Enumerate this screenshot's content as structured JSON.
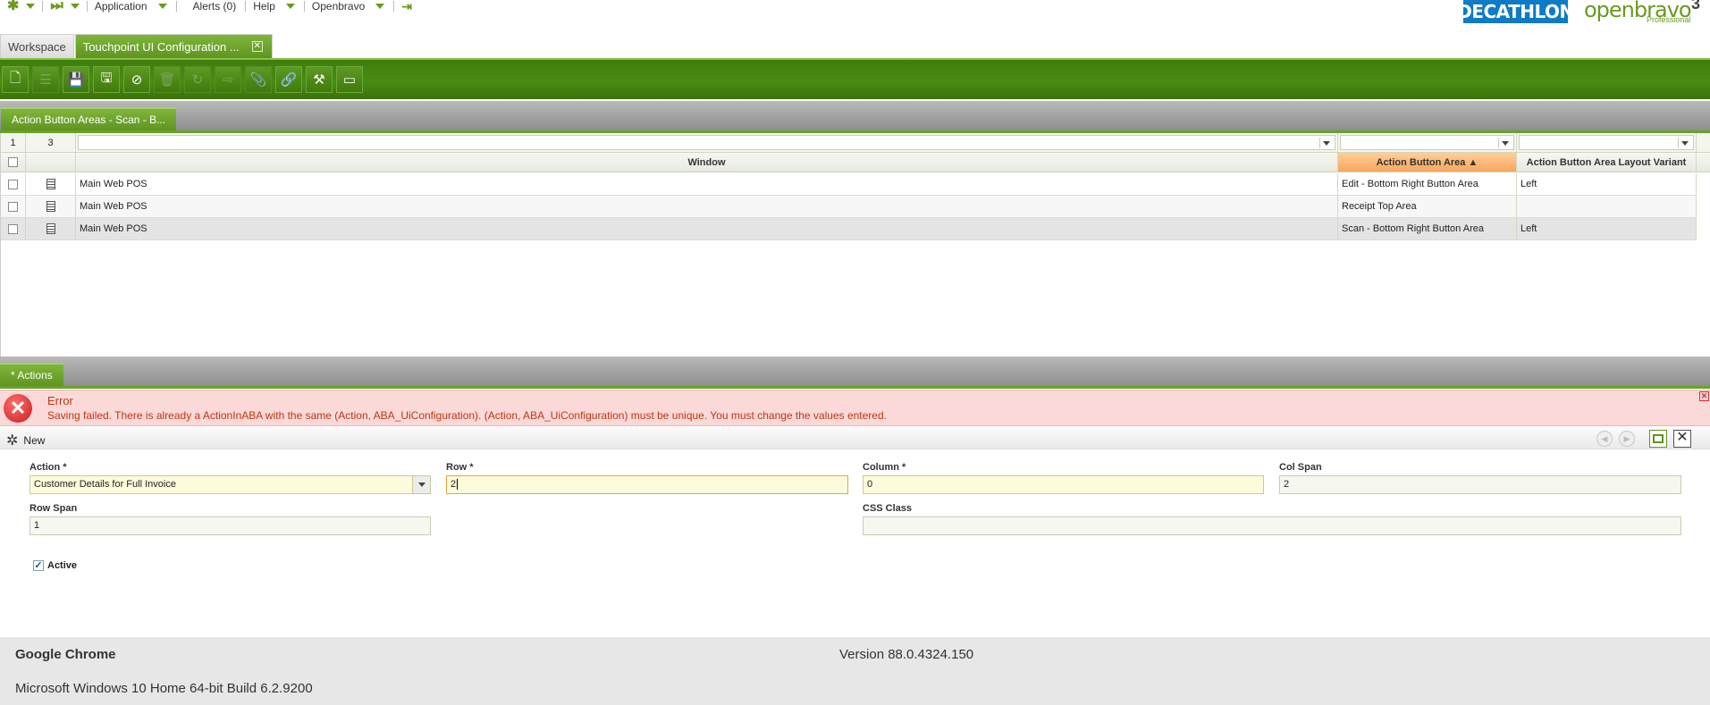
{
  "topmenu": {
    "application": "Application",
    "alerts": "Alerts (0)",
    "help": "Help",
    "openbravo": "Openbravo"
  },
  "logos": {
    "decathlon": "DECATHLON",
    "openbravo": "openbravo",
    "openbravo_edition": "Professional",
    "openbravo_version": "3"
  },
  "tabs": [
    {
      "label": "Workspace",
      "active": false
    },
    {
      "label": "Touchpoint UI Configuration ...",
      "active": true
    }
  ],
  "toolbar": {
    "buttons": [
      "new-document-icon",
      "new-row-icon",
      "save-icon",
      "save-close-icon",
      "undo-icon",
      "delete-icon",
      "refresh-icon",
      "export-icon",
      "attachment-icon",
      "link-icon",
      "tools-icon",
      "grid-view-icon"
    ]
  },
  "grid_section": {
    "tab_label": "Action Button Areas - Scan - B...",
    "selected_count": "1",
    "total_count": "3",
    "columns": [
      "Window",
      "Action Button Area",
      "Action Button Area Layout Variant"
    ],
    "sorted_column_marker": "▲",
    "rows": [
      {
        "window": "Main Web POS",
        "area": "Edit - Bottom Right Button Area",
        "variant": "Left"
      },
      {
        "window": "Main Web POS",
        "area": "Receipt Top Area",
        "variant": ""
      },
      {
        "window": "Main Web POS",
        "area": "Scan - Bottom Right Button Area",
        "variant": "Left"
      }
    ]
  },
  "actions_section": {
    "tab_label": "* Actions"
  },
  "error": {
    "title": "Error",
    "message": "Saving failed. There is already a ActionInABA with the same (Action, ABA_UiConfiguration). (Action, ABA_UiConfiguration) must be unique. You must change the values entered."
  },
  "form": {
    "mode_label": "New",
    "action_label": "Action *",
    "action_value": "Customer Details for Full Invoice",
    "row_label": "Row *",
    "row_value": "2",
    "column_label": "Column *",
    "column_value": "0",
    "colspan_label": "Col Span",
    "colspan_value": "2",
    "rowspan_label": "Row Span",
    "rowspan_value": "1",
    "cssclass_label": "CSS Class",
    "cssclass_value": "",
    "active_label": "Active",
    "active_checked": true
  },
  "footer": {
    "browser": "Google Chrome",
    "version": "Version 88.0.4324.150",
    "os": "Microsoft Windows 10 Home 64-bit Build 6.2.9200"
  }
}
